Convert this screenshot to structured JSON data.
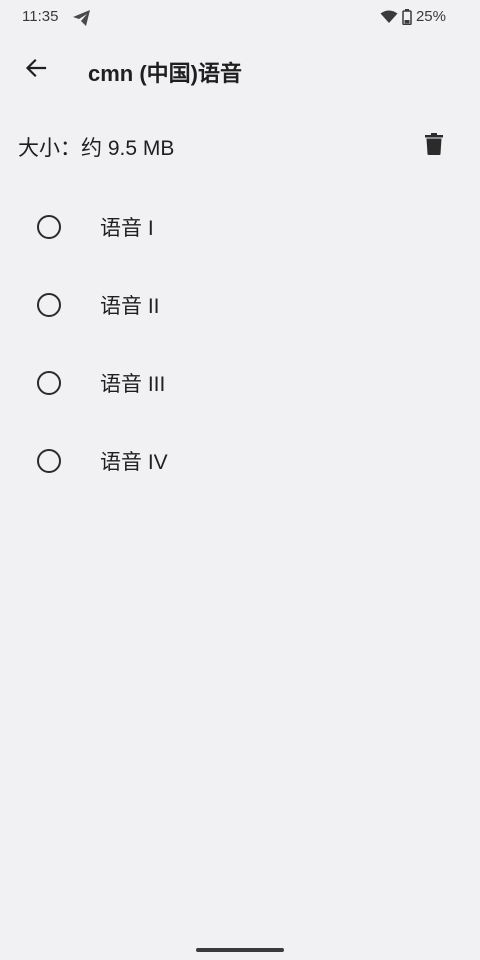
{
  "status_bar": {
    "time": "11:35",
    "battery_percent": "25%",
    "icons": [
      "telegram-icon",
      "wifi-icon",
      "battery-icon"
    ]
  },
  "app_bar": {
    "title": "cmn (中国)语音",
    "back_icon": "arrow-back-icon"
  },
  "size_row": {
    "label": "大小：约 9.5 MB",
    "delete_icon": "trash-icon"
  },
  "voices": [
    {
      "label": "语音 I",
      "selected": false
    },
    {
      "label": "语音 II",
      "selected": false
    },
    {
      "label": "语音 III",
      "selected": false
    },
    {
      "label": "语音 IV",
      "selected": false
    }
  ],
  "colors": {
    "background": "#f1f1f4",
    "text": "#1f1f1f",
    "icon": "#2b2b2b"
  }
}
